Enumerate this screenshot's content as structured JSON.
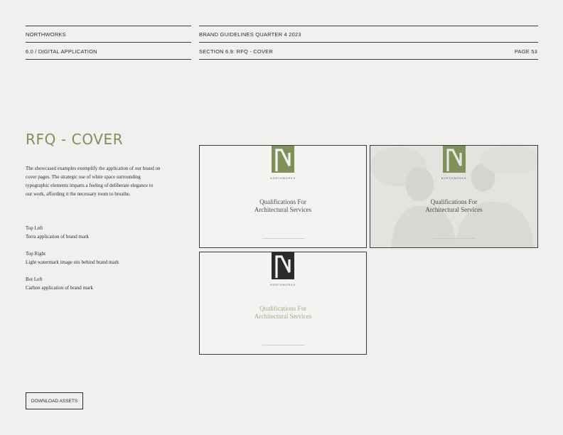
{
  "header": {
    "brand": "NORTHWORKS",
    "document": "BRAND GUIDELINES QUARTER 4 2023",
    "section_parent": "6.0 / DIGITAL APPLICATION",
    "section": "SECTION 6.9: RFQ - COVER",
    "page": "PAGE 53"
  },
  "main": {
    "title": "RFQ - COVER",
    "intro": "The showcased examples exemplify the application of our brand on cover pages. The strategic use of white space surrounding typographic elements imparts a feeling of deliberate elegance to our work, affording it the necessary room to breathe.",
    "notes": [
      {
        "heading": "Top Left",
        "text": "Terra application of brand mark"
      },
      {
        "heading": "Top Right",
        "text": "Light watermark image sits behind brand mark"
      },
      {
        "heading": "Bot Left",
        "text": "Carbon application of brand mark"
      }
    ],
    "download_label": "DOWNLOAD ASSETS"
  },
  "cards": [
    {
      "wordmark": "NORTHWORKS",
      "heading_line1": "Qualifications For",
      "heading_line2": "Architectural Services",
      "mark_color": "#7d9159",
      "heading_color": "#4a4a4a"
    },
    {
      "wordmark": "NORTHWORKS",
      "heading_line1": "Qualifications For",
      "heading_line2": "Architectural Services",
      "mark_color": "#7d9159",
      "heading_color": "#4a4a4a"
    },
    {
      "wordmark": "NORTHWORKS",
      "heading_line1": "Qualifications For",
      "heading_line2": "Architectural Services",
      "mark_color": "#2b2b2b",
      "heading_color": "#a3ab86"
    }
  ],
  "colors": {
    "terra": "#7d9159",
    "carbon": "#2b2b2b",
    "background": "#f1f0ef"
  }
}
